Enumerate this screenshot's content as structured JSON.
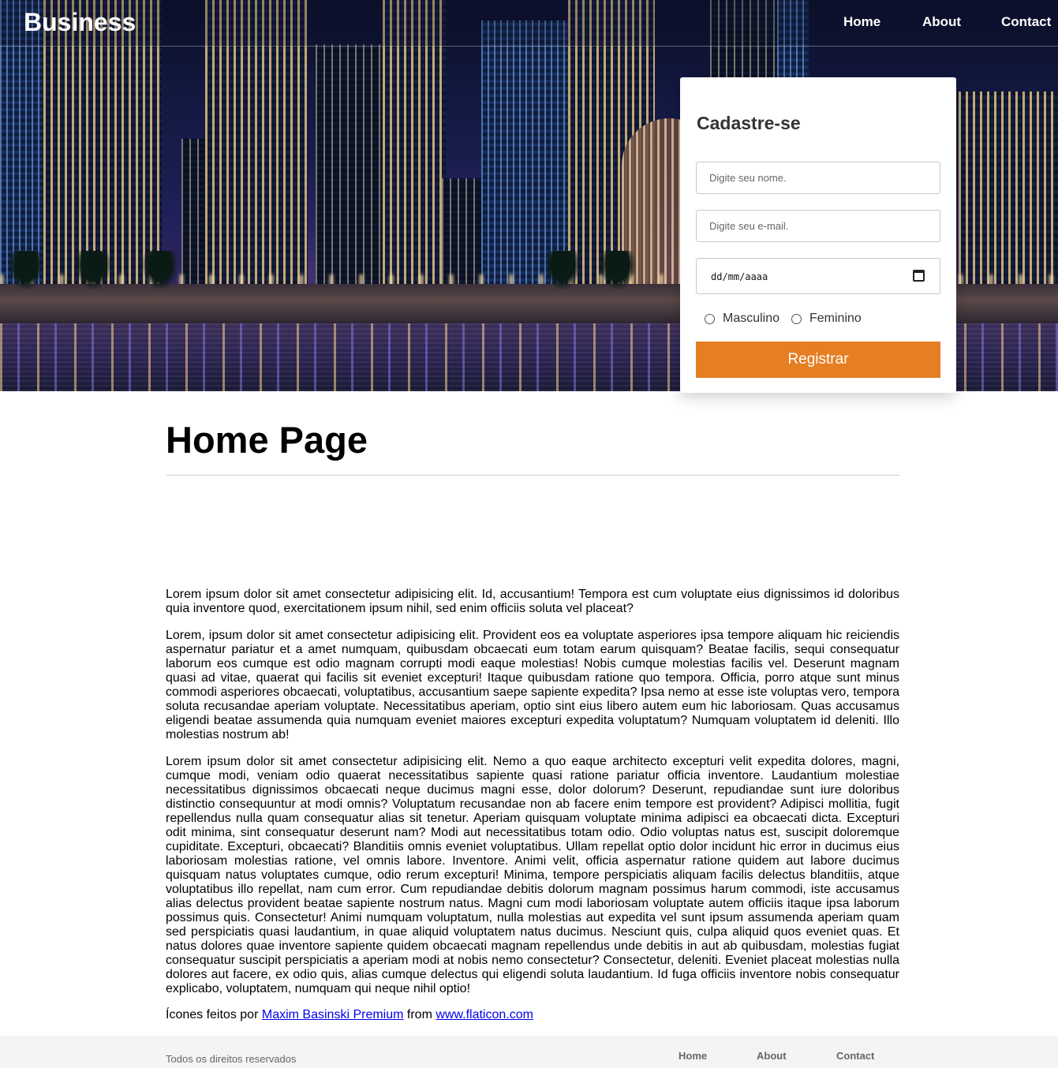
{
  "header": {
    "brand": "Business",
    "nav": [
      "Home",
      "About",
      "Contact"
    ]
  },
  "signup": {
    "title": "Cadastre-se",
    "name_placeholder": "Digite seu nome.",
    "email_placeholder": "Digite seu e-mail.",
    "date_placeholder": "dd/mm/aaaa",
    "gender_options": [
      "Masculino",
      "Feminino"
    ],
    "submit_label": "Registrar"
  },
  "main": {
    "title": "Home Page",
    "paragraphs": [
      "Lorem ipsum dolor sit amet consectetur adipisicing elit. Id, accusantium! Tempora est cum voluptate eius dignissimos id doloribus quia inventore quod, exercitationem ipsum nihil, sed enim officiis soluta vel placeat?",
      "Lorem, ipsum dolor sit amet consectetur adipisicing elit. Provident eos ea voluptate asperiores ipsa tempore aliquam hic reiciendis aspernatur pariatur et a amet numquam, quibusdam obcaecati eum totam earum quisquam? Beatae facilis, sequi consequatur laborum eos cumque est odio magnam corrupti modi eaque molestias! Nobis cumque molestias facilis vel. Deserunt magnam quasi ad vitae, quaerat qui facilis sit eveniet excepturi! Itaque quibusdam ratione quo tempora. Officia, porro atque sunt minus commodi asperiores obcaecati, voluptatibus, accusantium saepe sapiente expedita? Ipsa nemo at esse iste voluptas vero, tempora soluta recusandae aperiam voluptate. Necessitatibus aperiam, optio sint eius libero autem eum hic laboriosam. Quas accusamus eligendi beatae assumenda quia numquam eveniet maiores excepturi expedita voluptatum? Numquam voluptatem id deleniti. Illo molestias nostrum ab!",
      "Lorem ipsum dolor sit amet consectetur adipisicing elit. Nemo a quo eaque architecto excepturi velit expedita dolores, magni, cumque modi, veniam odio quaerat necessitatibus sapiente quasi ratione pariatur officia inventore. Laudantium molestiae necessitatibus dignissimos obcaecati neque ducimus magni esse, dolor dolorum? Deserunt, repudiandae sunt iure doloribus distinctio consequuntur at modi omnis? Voluptatum recusandae non ab facere enim tempore est provident? Adipisci mollitia, fugit repellendus nulla quam consequatur alias sit tenetur. Aperiam quisquam voluptate minima adipisci ea obcaecati dicta. Excepturi odit minima, sint consequatur deserunt nam? Modi aut necessitatibus totam odio. Odio voluptas natus est, suscipit doloremque cupiditate. Excepturi, obcaecati? Blanditiis omnis eveniet voluptatibus. Ullam repellat optio dolor incidunt hic error in ducimus eius laboriosam molestias ratione, vel omnis labore. Inventore. Animi velit, officia aspernatur ratione quidem aut labore ducimus quisquam natus voluptates cumque, odio rerum excepturi! Minima, tempore perspiciatis aliquam facilis delectus blanditiis, atque voluptatibus illo repellat, nam cum error. Cum repudiandae debitis dolorum magnam possimus harum commodi, iste accusamus alias delectus provident beatae sapiente nostrum natus. Magni cum modi laboriosam voluptate autem officiis itaque ipsa laborum possimus quis. Consectetur! Animi numquam voluptatum, nulla molestias aut expedita vel sunt ipsum assumenda aperiam quam sed perspiciatis quasi laudantium, in quae aliquid voluptatem natus ducimus. Nesciunt quis, culpa aliquid quos eveniet quas. Et natus dolores quae inventore sapiente quidem obcaecati magnam repellendus unde debitis in aut ab quibusdam, molestias fugiat consequatur suscipit perspiciatis a aperiam modi at nobis nemo consectetur? Consectetur, deleniti. Eveniet placeat molestias nulla dolores aut facere, ex odio quis, alias cumque delectus qui eligendi soluta laudantium. Id fuga officiis inventore nobis consequatur explicabo, voluptatem, numquam qui neque nihil optio!"
    ],
    "credits": {
      "prefix": "Ícones feitos por",
      "author_link": "Maxim Basinski Premium",
      "middle": "from",
      "site_link": "www.flaticon.com"
    }
  },
  "footer": {
    "copyright": "Todos os direitos reservados",
    "nav": [
      "Home",
      "About",
      "Contact"
    ]
  },
  "colors": {
    "accent": "#e67e22",
    "footer_bg": "#f4f4f4",
    "link": "#0000ee"
  }
}
